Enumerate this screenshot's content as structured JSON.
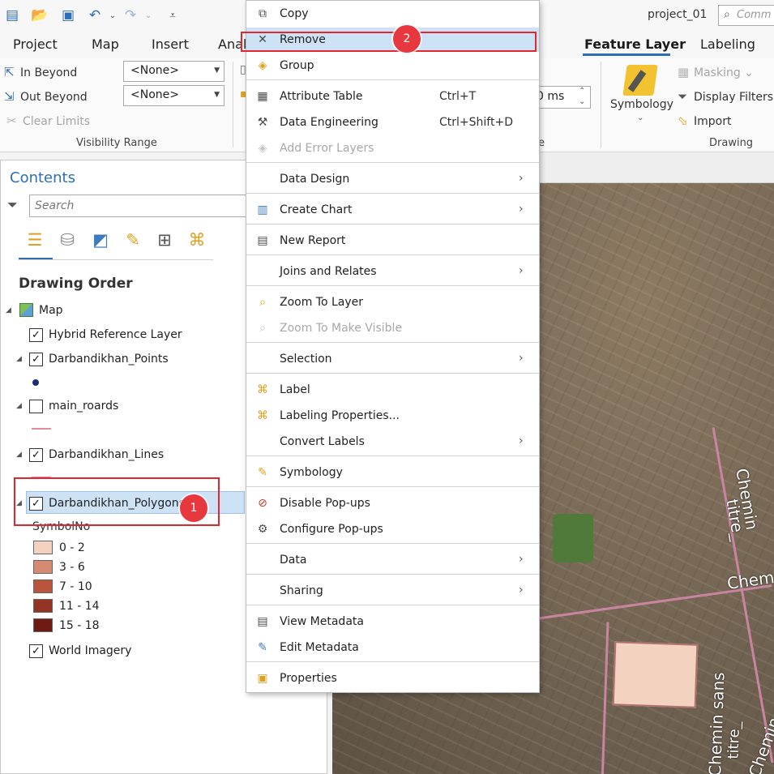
{
  "app": {
    "project_name": "project_01",
    "command_search_placeholder": "Comm"
  },
  "tabs": {
    "project": "Project",
    "map": "Map",
    "insert": "Insert",
    "analysis": "Anal",
    "feature_layer": "Feature Layer",
    "labeling": "Labeling"
  },
  "ribbon": {
    "in_beyond": "In Beyond",
    "out_beyond": "Out Beyond",
    "clear_limits": "Clear Limits",
    "in_beyond_value": "<None>",
    "out_beyond_value": "<None>",
    "visibility_range_label": "Visibility Range",
    "ms_value": "0 ms",
    "partial_group_label": "e",
    "symbology": "Symbology",
    "masking": "Masking",
    "display_filters": "Display Filters",
    "import": "Import",
    "drawing_label": "Drawing"
  },
  "contents": {
    "title": "Contents",
    "search_placeholder": "Search",
    "drawing_order": "Drawing Order",
    "map_label": "Map",
    "layers": {
      "hybrid": "Hybrid Reference Layer",
      "points": "Darbandikhan_Points",
      "roads": "main_roards",
      "lines": "Darbandikhan_Lines",
      "polygons": "Darbandikhan_Polygons",
      "imagery": "World Imagery"
    },
    "legend_title": "SymbolNo",
    "legend": [
      {
        "label": "0 - 2",
        "color": "#f4d2c0"
      },
      {
        "label": "3 - 6",
        "color": "#d68a72"
      },
      {
        "label": "7 - 10",
        "color": "#b8553c"
      },
      {
        "label": "11 - 14",
        "color": "#933425"
      },
      {
        "label": "15 - 18",
        "color": "#6e1a14"
      }
    ]
  },
  "badges": {
    "one": "1",
    "two": "2"
  },
  "map": {
    "label_a": "Chemin",
    "label_b": "titre_",
    "label_c": "Chem",
    "label_d": "Chemin sans",
    "label_e": "titre_",
    "label_f": "Chemin sans"
  },
  "menu": {
    "copy": "Copy",
    "remove": "Remove",
    "group": "Group",
    "attribute_table": "Attribute Table",
    "attribute_table_sc": "Ctrl+T",
    "data_engineering": "Data Engineering",
    "data_engineering_sc": "Ctrl+Shift+D",
    "add_error_layers": "Add Error Layers",
    "data_design": "Data Design",
    "create_chart": "Create Chart",
    "new_report": "New Report",
    "joins_relates": "Joins and Relates",
    "zoom_to_layer": "Zoom To Layer",
    "zoom_visible": "Zoom To Make Visible",
    "selection": "Selection",
    "label": "Label",
    "labeling_properties": "Labeling Properties...",
    "convert_labels": "Convert Labels",
    "symbology": "Symbology",
    "disable_popups": "Disable Pop-ups",
    "configure_popups": "Configure Pop-ups",
    "data": "Data",
    "sharing": "Sharing",
    "view_metadata": "View Metadata",
    "edit_metadata": "Edit Metadata",
    "properties": "Properties"
  }
}
